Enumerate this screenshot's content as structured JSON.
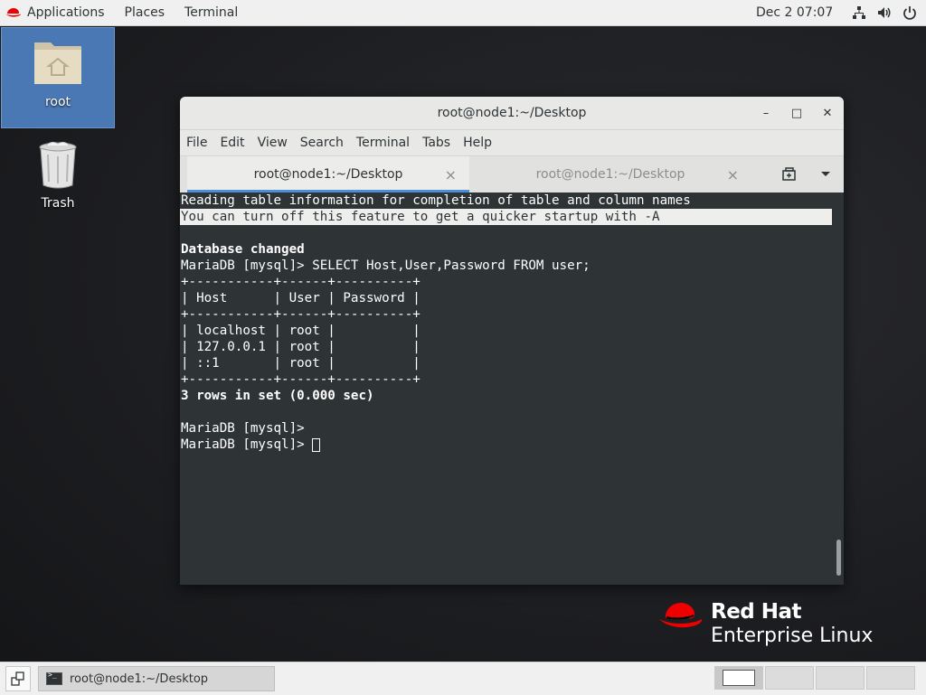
{
  "top_panel": {
    "applications": "Applications",
    "places": "Places",
    "terminal": "Terminal",
    "clock": "Dec 2  07:07",
    "icons": [
      "network-icon",
      "volume-icon",
      "power-icon"
    ]
  },
  "desktop": {
    "icons": [
      {
        "label": "root",
        "icon": "home-folder-icon"
      },
      {
        "label": "Trash",
        "icon": "trash-icon"
      }
    ]
  },
  "window": {
    "title": "root@node1:~/Desktop",
    "controls": {
      "minimize": "–",
      "maximize": "□",
      "close": "✕"
    },
    "menu": [
      "File",
      "Edit",
      "View",
      "Search",
      "Terminal",
      "Tabs",
      "Help"
    ],
    "tabs": [
      {
        "label": "root@node1:~/Desktop",
        "active": true
      },
      {
        "label": "root@node1:~/Desktop",
        "active": false
      }
    ],
    "tab_close": "×",
    "terminal_lines": [
      "Reading table information for completion of table and column names",
      "You can turn off this feature to get a quicker startup with -A",
      "",
      "Database changed",
      "MariaDB [mysql]> SELECT Host,User,Password FROM user;",
      "+-----------+------+----------+",
      "| Host      | User | Password |",
      "+-----------+------+----------+",
      "| localhost | root |          |",
      "| 127.0.0.1 | root |          |",
      "| ::1       | root |          |",
      "+-----------+------+----------+",
      "3 rows in set (0.000 sec)",
      "",
      "MariaDB [mysql]> ",
      "MariaDB [mysql]> "
    ]
  },
  "branding": {
    "brand": "Red Hat",
    "product": "Enterprise Linux",
    "accent": "#ee0000"
  },
  "bottom_panel": {
    "task_label": "root@node1:~/Desktop",
    "workspaces": 4
  }
}
